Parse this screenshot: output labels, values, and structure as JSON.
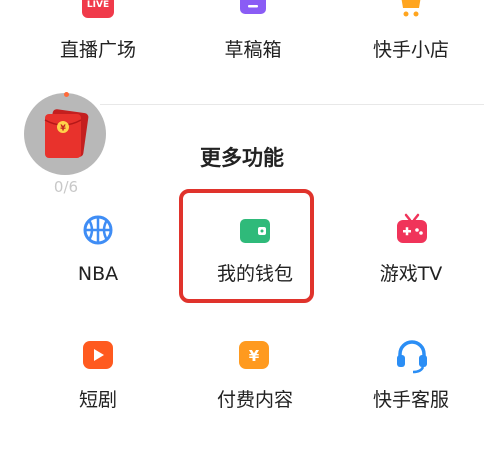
{
  "top_row": [
    {
      "label": "直播广场",
      "icon": "live-icon",
      "badge": "LIVE",
      "color": "#f03a4a"
    },
    {
      "label": "草稿箱",
      "icon": "drafts-icon",
      "color": "#8a5cf5"
    },
    {
      "label": "快手小店",
      "icon": "shop-cart-icon",
      "color": "#ffa51f"
    }
  ],
  "floating_widget": {
    "icon": "red-envelope-icon",
    "counter": "0/6",
    "color": "#e8322c"
  },
  "section": {
    "title": "更多功能"
  },
  "grid_row1": [
    {
      "label": "NBA",
      "icon": "basketball-icon",
      "color": "#3f8df5"
    },
    {
      "label": "我的钱包",
      "icon": "wallet-icon",
      "color": "#2fba7a"
    },
    {
      "label": "游戏TV",
      "icon": "game-tv-icon",
      "color": "#f0345a"
    }
  ],
  "grid_row2": [
    {
      "label": "短剧",
      "icon": "play-icon",
      "color": "#ff5a1f"
    },
    {
      "label": "付费内容",
      "icon": "yuan-icon",
      "color": "#ff9a1f",
      "glyph": "¥"
    },
    {
      "label": "快手客服",
      "icon": "headset-icon",
      "color": "#2b8ef5"
    }
  ],
  "highlight": {
    "target": "我的钱包",
    "color": "#e0332c"
  }
}
